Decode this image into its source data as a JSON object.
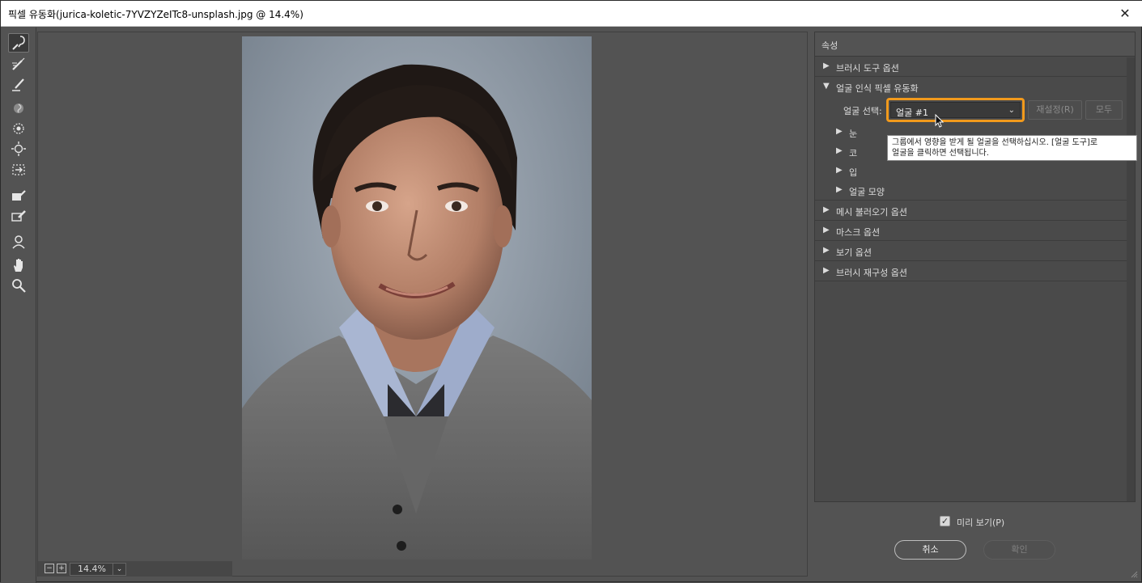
{
  "window": {
    "title": "픽셀 유동화(jurica-koletic-7YVZYZeITc8-unsplash.jpg @ 14.4%)",
    "close_glyph": "✕"
  },
  "toolbar": {
    "tools": [
      "forward-warp-tool",
      "reconstruct-tool",
      "smooth-tool",
      "twirl-tool",
      "pucker-tool",
      "bloat-tool",
      "push-left-tool",
      "freeze-mask-tool",
      "thaw-mask-tool",
      "face-tool",
      "hand-tool",
      "zoom-tool"
    ]
  },
  "canvas": {
    "zoom_value": "14.4%",
    "zoom_dropdown_glyph": "⌄"
  },
  "panel": {
    "header": "속성",
    "sections": {
      "brush_tool_options": "브러시 도구 옵션",
      "face_aware_liquify": "얼굴 인식 픽셀 유동화",
      "mesh_load_options": "메시 불러오기 옵션",
      "mask_options": "마스크 옵션",
      "view_options": "보기 옵션",
      "brush_reconstruct_options": "브러시 재구성 옵션"
    },
    "face_select": {
      "label": "얼굴 선택:",
      "value": "얼굴 #1",
      "reset_label": "재설정(R)",
      "all_label": "모두"
    },
    "sub_sections": {
      "eyes": "눈",
      "nose": "코",
      "mouth": "입",
      "face_shape": "얼굴 모양"
    },
    "tooltip": {
      "line1": "그룹에서 영향을 받게 될 얼굴을 선택하십시오. [얼굴 도구]로",
      "line2": "얼굴을 클릭하면 선택됩니다."
    }
  },
  "footer": {
    "preview_label": "미리 보기(P)",
    "preview_checked": true,
    "cancel_label": "취소",
    "ok_label": "확인"
  },
  "colors": {
    "accent_orange": "#f29a1c",
    "ui_bg": "#535353",
    "panel_bg": "#4a4a4a"
  }
}
